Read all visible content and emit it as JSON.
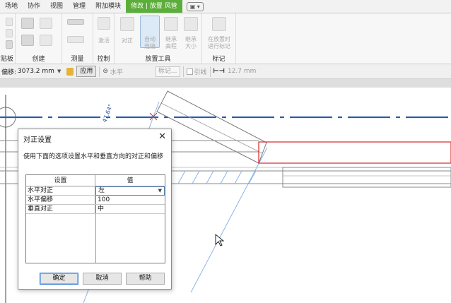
{
  "ribbon": {
    "tabs": [
      "场地",
      "协作",
      "视图",
      "管理",
      "附加模块",
      "修改 | 放置 风管"
    ],
    "active_tab_index": 5,
    "panels": {
      "clipboard": "剪贴板",
      "create": "创建",
      "measure": "测量",
      "control": "控制",
      "placement": "放置工具",
      "tag": "标记"
    },
    "buttons": {
      "activate": "激活",
      "justify": "对正",
      "auto_connect": "自动\n连接",
      "inherit_elevation": "继承\n高程",
      "inherit_size": "继承\n大小",
      "tag_on_placement": "在放置时\n进行标记"
    }
  },
  "options_bar": {
    "offset_label": "偏移:",
    "offset_value": "3073.2 mm",
    "apply_label": "应用",
    "orientation_value": "水平",
    "tag_field": "标记...",
    "leader_label": "引线",
    "length_value": "12.7 mm"
  },
  "canvas": {
    "dimension_text": "47.64°",
    "accent_blue": "#2a5caa",
    "outline_red": "#d9252a"
  },
  "dialog": {
    "title": "对正设置",
    "description": "使用下面的选项设置水平和垂直方向的对正和偏移",
    "columns": [
      "设置",
      "值"
    ],
    "rows": [
      {
        "key": "水平对正",
        "value": "左",
        "is_dropdown": true
      },
      {
        "key": "水平偏移",
        "value": "100"
      },
      {
        "key": "垂直对正",
        "value": "中"
      }
    ],
    "buttons": {
      "ok": "确定",
      "cancel": "取消",
      "help": "帮助"
    }
  }
}
